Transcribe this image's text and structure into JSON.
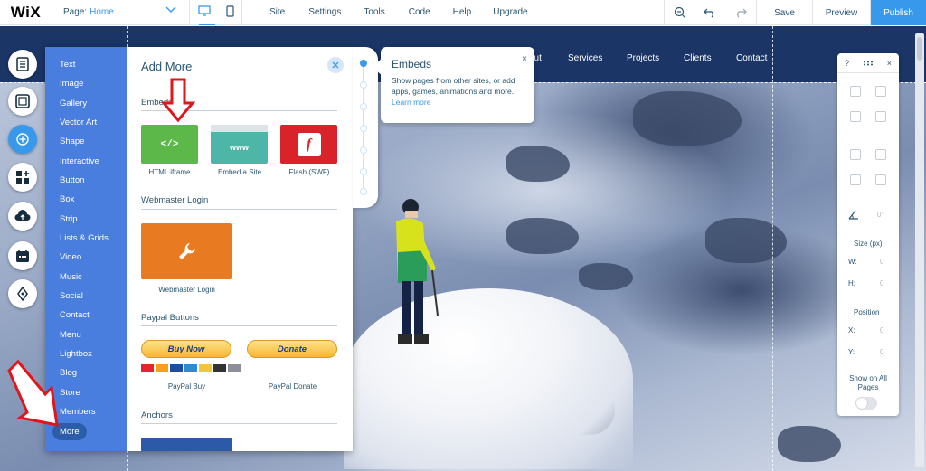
{
  "topbar": {
    "logo": "WiX",
    "page_label": "Page:",
    "page_value": "Home",
    "menu": [
      "Site",
      "Settings",
      "Tools",
      "Code",
      "Help",
      "Upgrade"
    ],
    "save": "Save",
    "preview": "Preview",
    "publish": "Publish"
  },
  "site_nav": [
    "out",
    "Services",
    "Projects",
    "Clients",
    "Contact"
  ],
  "left_toolbar": [
    "menus-pages-icon",
    "background-icon",
    "add-icon",
    "app-market-icon",
    "upload-icon",
    "bookings-icon",
    "blog-icon"
  ],
  "add_panel": {
    "categories": [
      "Text",
      "Image",
      "Gallery",
      "Vector Art",
      "Shape",
      "Interactive",
      "Button",
      "Box",
      "Strip",
      "Lists & Grids",
      "Video",
      "Music",
      "Social",
      "Contact",
      "Menu",
      "Lightbox",
      "Blog",
      "Store",
      "Members",
      "More"
    ],
    "selected": "More",
    "title": "Add More",
    "sections": {
      "embeds": "Embeds",
      "webmaster": "Webmaster Login",
      "paypal": "Paypal Buttons",
      "anchors": "Anchors"
    },
    "embed_items": [
      {
        "icon": "</>",
        "label": "HTML iframe",
        "color": "#5cb848"
      },
      {
        "icon": "www",
        "label": "Embed a Site",
        "color": "#4db6a6"
      },
      {
        "icon": "f",
        "label": "Flash (SWF)",
        "color": "#d8232a"
      }
    ],
    "webmaster_item": {
      "label": "Webmaster Login",
      "color": "#e87b22"
    },
    "paypal_items": [
      {
        "button": "Buy Now",
        "label": "PayPal Buy"
      },
      {
        "button": "Donate",
        "label": "PayPal Donate"
      }
    ]
  },
  "tooltip": {
    "title": "Embeds",
    "desc": "Show pages from other sites, or add apps, games, animations and more.",
    "link": "Learn more",
    "close": "×"
  },
  "inspector": {
    "help": "?",
    "close": "×",
    "angle": "0°",
    "size_label": "Size (px)",
    "w_label": "W:",
    "w_value": "0",
    "h_label": "H:",
    "h_value": "0",
    "position_label": "Position",
    "x_label": "X:",
    "x_value": "0",
    "y_label": "Y:",
    "y_value": "0",
    "show_all_label": "Show on All Pages"
  },
  "colors": {
    "accent": "#3899ec",
    "annotation": "#e0161b",
    "panel_categories": "#4a7ede"
  }
}
